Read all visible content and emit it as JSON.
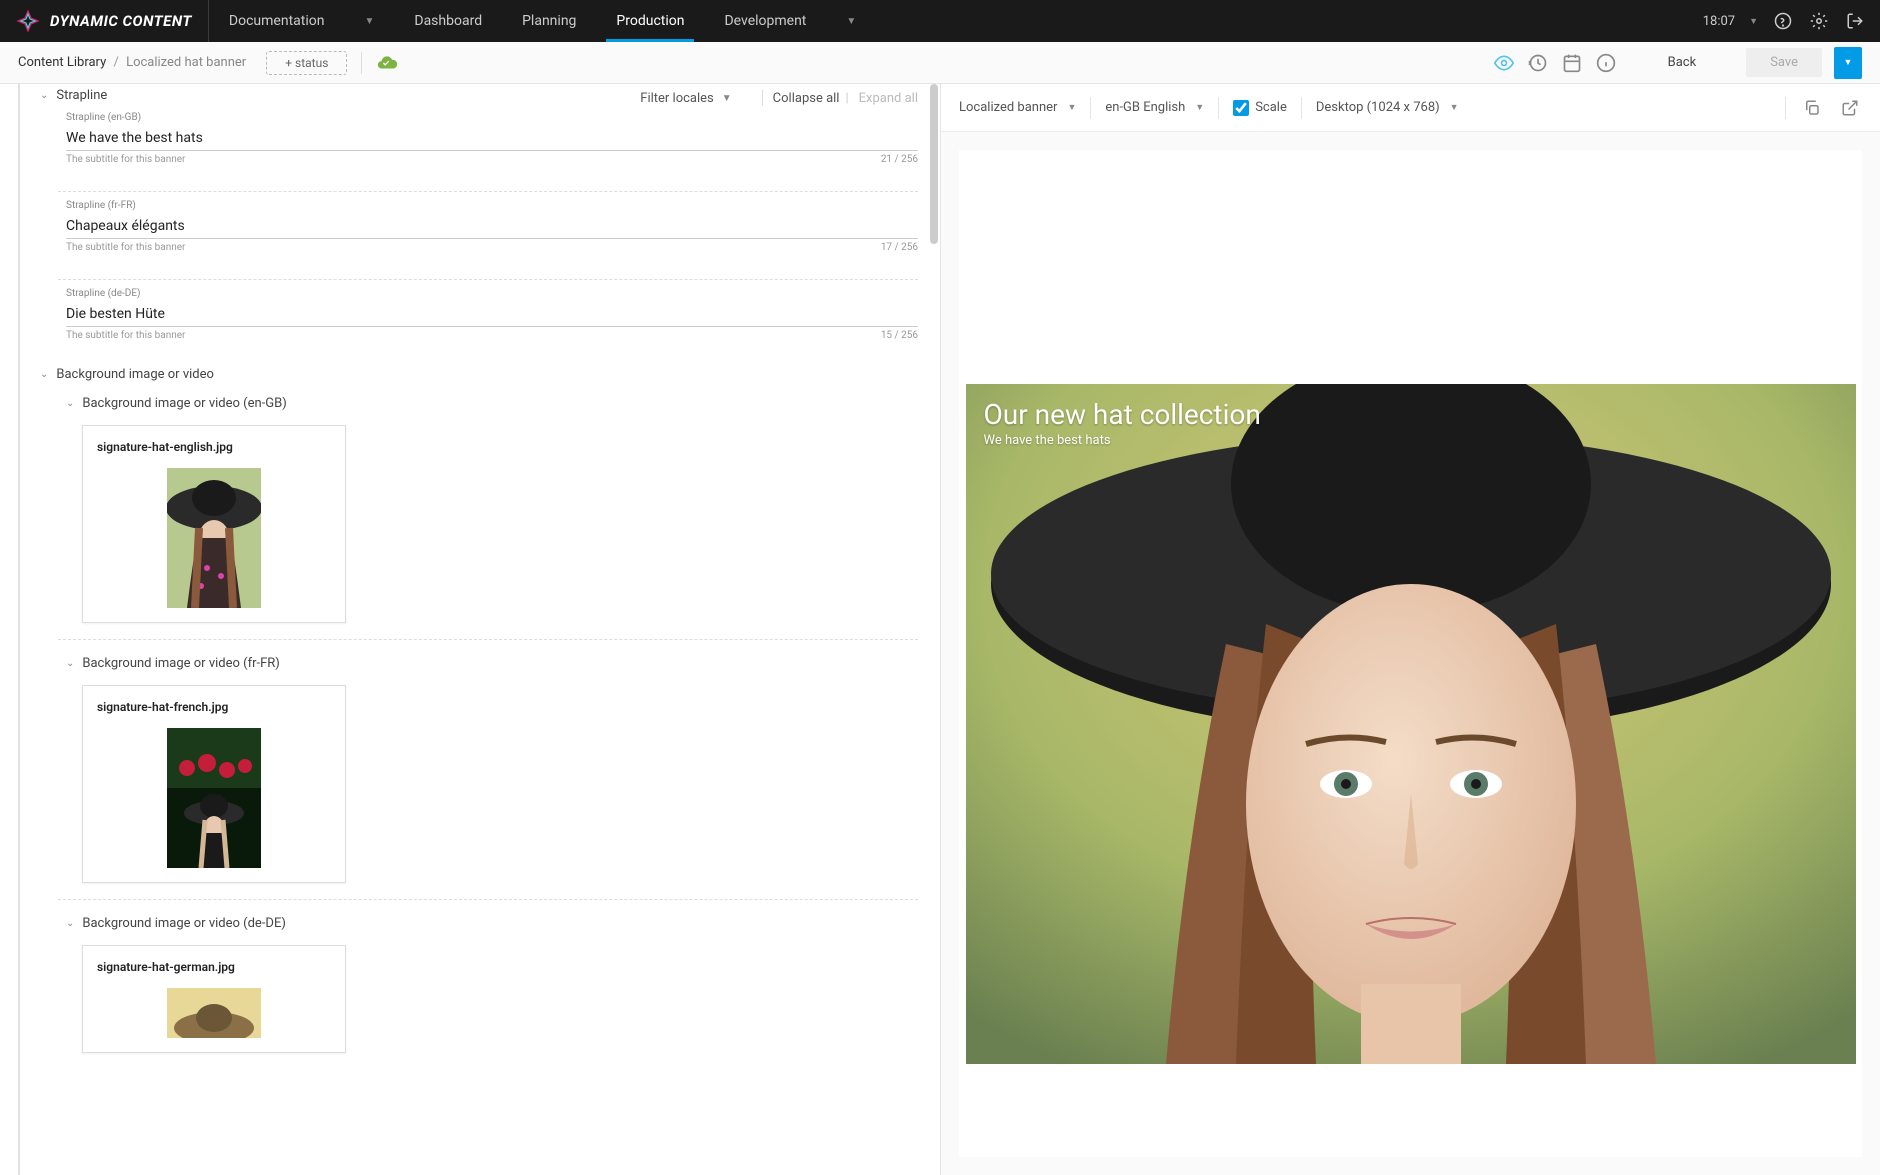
{
  "brand": "DYNAMIC CONTENT",
  "nav": {
    "documentation": "Documentation",
    "items": [
      "Dashboard",
      "Planning",
      "Production",
      "Development"
    ],
    "active": 2,
    "time": "18:07"
  },
  "subheader": {
    "crumb_root": "Content Library",
    "crumb_current": "Localized hat banner",
    "status_btn": "+ status",
    "back": "Back",
    "save": "Save"
  },
  "filters": {
    "filter_locales": "Filter locales",
    "collapse_all": "Collapse all",
    "expand_all": "Expand all"
  },
  "strapline": {
    "header": "Strapline",
    "help": "The subtitle for this banner",
    "locales": [
      {
        "label": "Strapline (en-GB)",
        "value": "We have the best hats",
        "count": "21 / 256"
      },
      {
        "label": "Strapline (fr-FR)",
        "value": "Chapeaux élégants",
        "count": "17 / 256"
      },
      {
        "label": "Strapline (de-DE)",
        "value": "Die besten Hüte",
        "count": "15 / 256"
      }
    ]
  },
  "bg_section": {
    "header": "Background image or video",
    "groups": [
      {
        "header": "Background image or video (en-GB)",
        "filename": "signature-hat-english.jpg"
      },
      {
        "header": "Background image or video (fr-FR)",
        "filename": "signature-hat-french.jpg"
      },
      {
        "header": "Background image or video (de-DE)",
        "filename": "signature-hat-german.jpg"
      }
    ]
  },
  "preview": {
    "content_type": "Localized banner",
    "locale": "en-GB English",
    "scale_label": "Scale",
    "device": "Desktop (1024 x 768)",
    "banner_title": "Our new hat collection",
    "banner_sub": "We have the best hats"
  }
}
